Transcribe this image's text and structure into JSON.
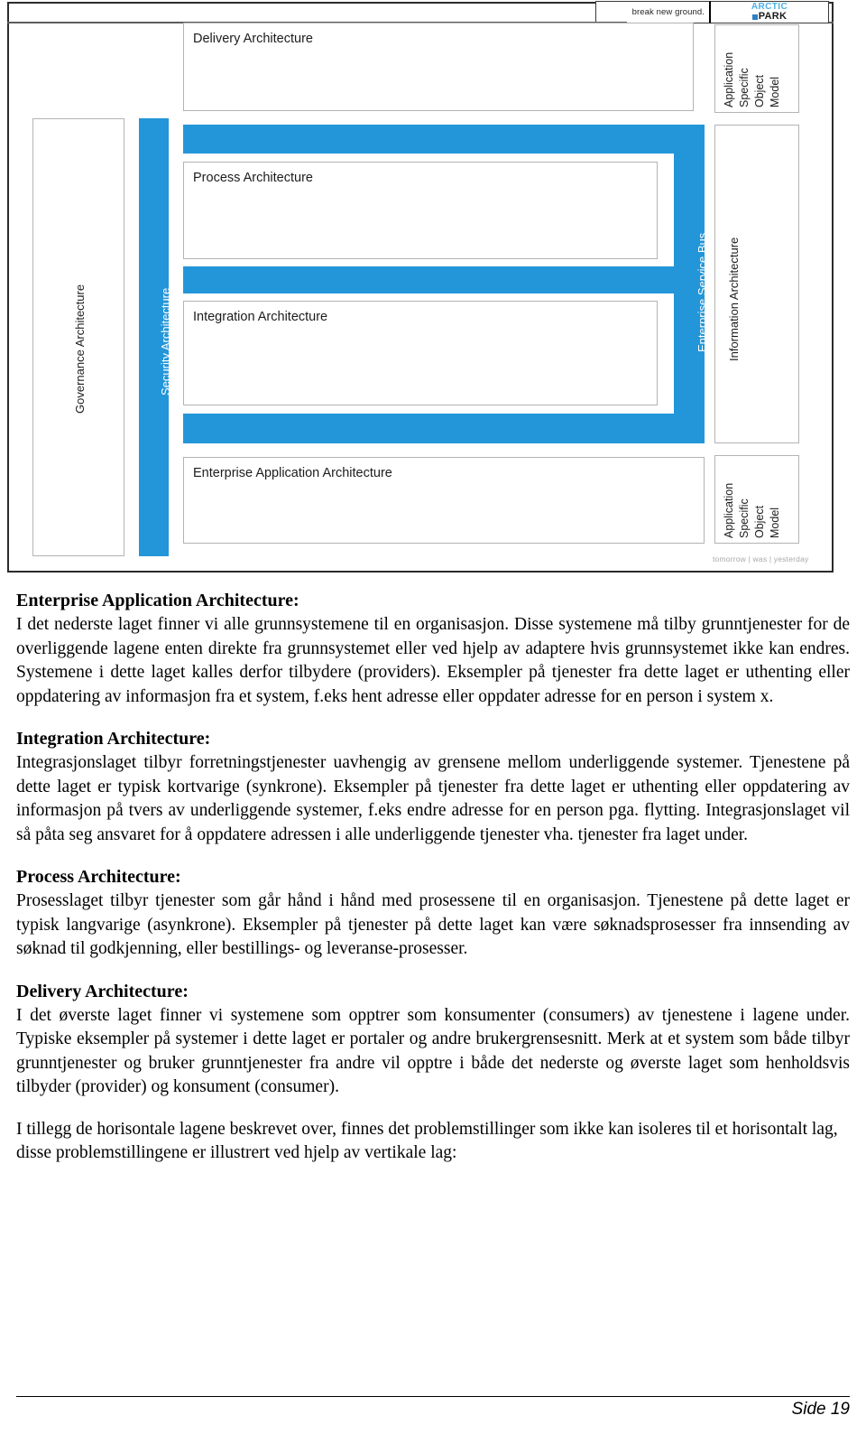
{
  "colors": {
    "accent_blue": "#2396d9",
    "logo_blue": "#49b0e4",
    "box_border": "#b3b3b3"
  },
  "figure": {
    "header": {
      "tagline": "break new ground.",
      "logo_top": "ARCTIC",
      "logo_bottom": "PARK"
    },
    "layers": [
      {
        "id": "delivery",
        "label": "Delivery Architecture"
      },
      {
        "id": "process",
        "label": "Process Architecture"
      },
      {
        "id": "integration",
        "label": "Integration Architecture"
      },
      {
        "id": "entapp",
        "label": "Enterprise Application Architecture"
      }
    ],
    "vertical_layers": [
      {
        "id": "governance",
        "label": "Governance Architecture"
      },
      {
        "id": "security",
        "label": "Security Architecture"
      },
      {
        "id": "esb",
        "label": "Enterprise Service Bus"
      },
      {
        "id": "information",
        "label": "Information Architecture"
      }
    ],
    "object_model": {
      "lines": [
        "Application",
        "Specific",
        "Object",
        "Model"
      ]
    },
    "footer_tagline": "tomorrow | was | yesterday"
  },
  "sections": [
    {
      "heading": "Enterprise Application Architecture:",
      "body": "I det nederste laget finner vi alle grunnsystemene til en organisasjon. Disse systemene må tilby grunntjenester for de overliggende lagene enten direkte fra grunnsystemet eller ved hjelp av adaptere hvis grunnsystemet ikke kan endres. Systemene i dette laget kalles derfor tilbydere (providers). Eksempler på tjenester fra dette laget er uthenting eller oppdatering av informasjon fra et system, f.eks hent adresse eller oppdater adresse for en person i system x."
    },
    {
      "heading": "Integration Architecture:",
      "body": "Integrasjonslaget tilbyr forretningstjenester uavhengig av grensene mellom underliggende systemer. Tjenestene på dette laget er typisk kortvarige (synkrone). Eksempler på tjenester fra dette laget er uthenting eller oppdatering av informasjon på tvers av underliggende systemer, f.eks endre adresse for en person pga. flytting. Integrasjonslaget vil så påta seg ansvaret for å oppdatere adressen i alle underliggende tjenester vha. tjenester fra laget under."
    },
    {
      "heading": "Process Architecture:",
      "body": "Prosesslaget tilbyr tjenester som går hånd i hånd med prosessene til en organisasjon. Tjenestene på dette laget er typisk langvarige (asynkrone). Eksempler på tjenester på dette laget kan være søknadsprosesser fra innsending av søknad til godkjenning, eller bestillings- og leveranse-prosesser."
    },
    {
      "heading": "Delivery Architecture:",
      "body": "I det øverste laget finner vi systemene som opptrer som konsumenter (consumers) av tjenestene i lagene under. Typiske eksempler på systemer i dette laget er portaler og andre brukergrensesnitt. Merk at et system som både tilbyr grunntjenester og bruker grunntjenester fra andre vil opptre i både det nederste og øverste laget som henholdsvis tilbyder (provider) og konsument (consumer)."
    }
  ],
  "closing_paragraph": "I tillegg de horisontale lagene beskrevet over, finnes det problemstillinger som ikke kan isoleres til et horisontalt lag, disse problemstillingene er illustrert ved hjelp av vertikale lag:",
  "page_footer": {
    "page_label": "Side 19"
  }
}
